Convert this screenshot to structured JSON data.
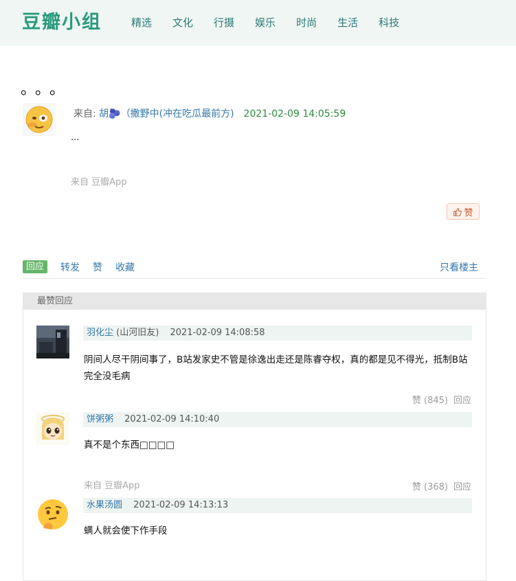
{
  "site": {
    "logo": "豆瓣小组",
    "nav": [
      "精选",
      "文化",
      "行摄",
      "娱乐",
      "时尚",
      "生活",
      "科技"
    ]
  },
  "post": {
    "title": "。。。",
    "from_label": "来自: ",
    "author": "胡🫐（撒野中(冲在吃瓜最前方)",
    "time": "2021-02-09 14:05:59",
    "body": "...",
    "source": "来自 豆瓣App",
    "like_label": "赞"
  },
  "actions": {
    "reply": "回应",
    "repost": "转发",
    "like": "赞",
    "collect": "收藏",
    "op_only": "只看楼主"
  },
  "comments_section": {
    "header": "最赞回应",
    "comments": [
      {
        "name": "羽化尘",
        "location": "(山河旧友)",
        "time": "2021-02-09 14:08:58",
        "text": "阴间人尽干阴间事了，B站发家史不管是徐逸出走还是陈睿夺权，真的都是见不得光，抵制B站完全没毛病",
        "likes": "赞 (845)",
        "reply": "回应"
      },
      {
        "name": "饼粥粥",
        "location": "",
        "time": "2021-02-09 14:10:40",
        "text": "真不是个东西□□□□",
        "source": "来自 豆瓣App",
        "likes": "赞 (368)",
        "reply": "回应"
      },
      {
        "name": "水果汤圆",
        "location": "",
        "time": "2021-02-09 14:13:13",
        "text": "螨人就会使下作手段"
      }
    ]
  }
}
